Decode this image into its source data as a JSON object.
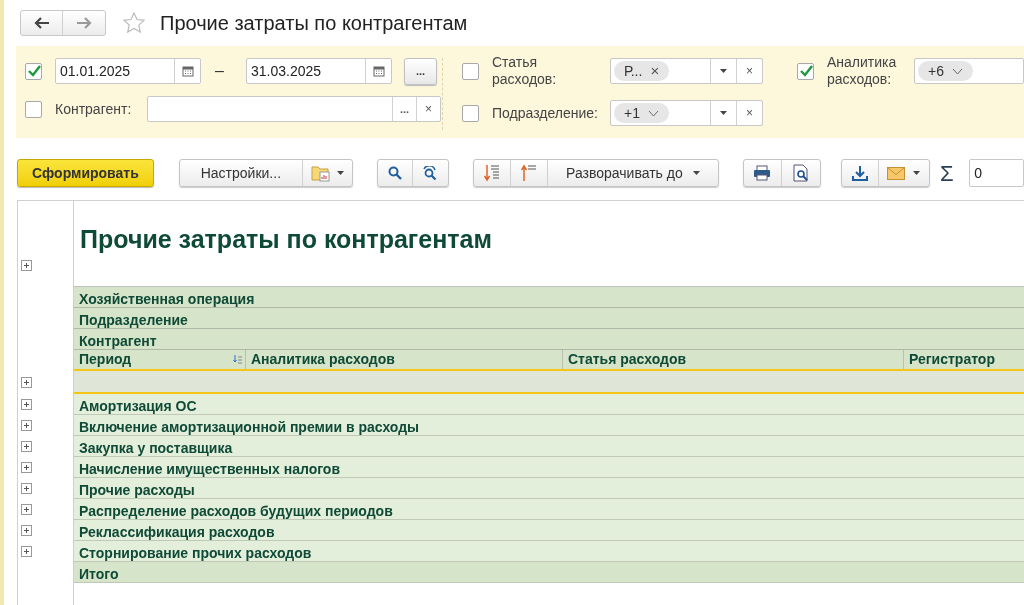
{
  "window": {
    "title": "Прочие затраты по контрагентам",
    "favorite": false
  },
  "filters": {
    "period": {
      "checked": true,
      "from": "01.01.2025",
      "to": "31.03.2025",
      "dash": "–",
      "more": "..."
    },
    "counterparty": {
      "checked": false,
      "label": "Контрагент:",
      "more": "...",
      "clear": "×"
    },
    "expense_item": {
      "checked": false,
      "label": "Статья расходов:",
      "tag": "Р...",
      "tag_close": "×",
      "clear": "×"
    },
    "department": {
      "checked": false,
      "label": "Подразделение:",
      "tag": "+1",
      "clear": "×"
    },
    "expense_analytics": {
      "checked": true,
      "label": "Аналитика расходов:",
      "tag": "+6"
    }
  },
  "toolbar": {
    "generate": "Сформировать",
    "settings": "Настройки...",
    "expand_to": "Разворачивать до",
    "sigma": "Σ",
    "sigma_value": "0"
  },
  "report": {
    "title": "Прочие затраты по контрагентам",
    "title_expandable": true,
    "header_rows": [
      "Хозяйственная операция",
      "Подразделение",
      "Контрагент"
    ],
    "columns": [
      "Период",
      "Аналитика расходов",
      "Статья расходов",
      "Регистратор"
    ],
    "rows": [
      {
        "kind": "empty",
        "expandable": true
      },
      {
        "kind": "group",
        "label": "Амортизация ОС",
        "expandable": true
      },
      {
        "kind": "group",
        "label": "Включение амортизационной премии в расходы",
        "expandable": true
      },
      {
        "kind": "group",
        "label": "Закупка у поставщика",
        "expandable": true
      },
      {
        "kind": "group",
        "label": "Начисление имущественных налогов",
        "expandable": true
      },
      {
        "kind": "group",
        "label": "Прочие расходы",
        "expandable": true
      },
      {
        "kind": "group",
        "label": "Распределение расходов будущих периодов",
        "expandable": true
      },
      {
        "kind": "group",
        "label": "Реклассификация расходов",
        "expandable": true
      },
      {
        "kind": "group",
        "label": "Сторнирование прочих расходов",
        "expandable": true
      },
      {
        "kind": "total",
        "label": "Итого",
        "expandable": false
      }
    ]
  }
}
